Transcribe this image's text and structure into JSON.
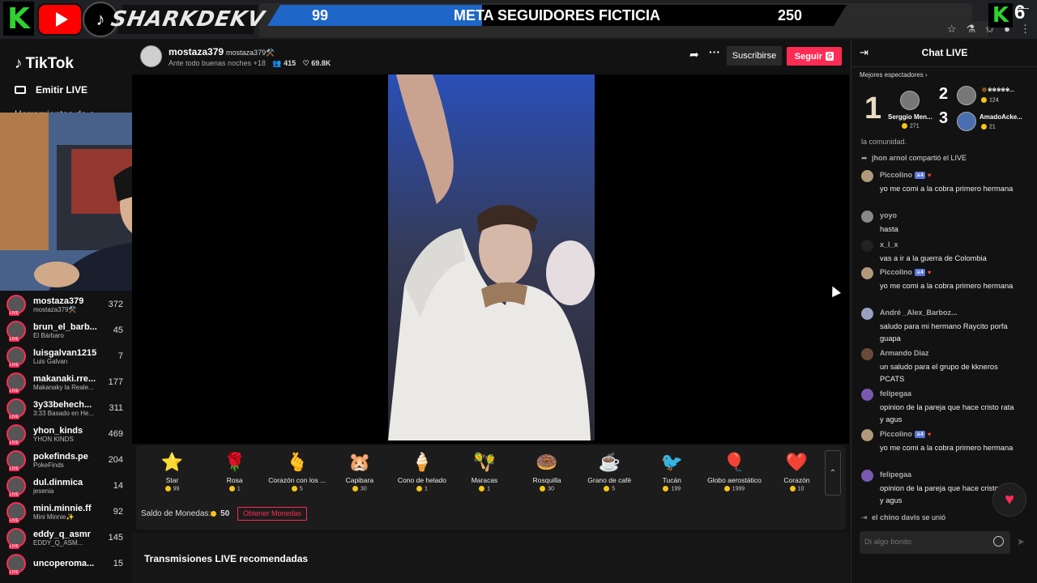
{
  "overlay": {
    "k_logo": "K",
    "brand": "SHARKDEKV",
    "goal": {
      "left": "99",
      "title": "META SEGUIDORES FICTICIA",
      "right": "250",
      "progress_fraction": 0.37
    },
    "k_right": "K",
    "k_count": "6"
  },
  "sidebar": {
    "logo": "TikTok",
    "emitir": "Emitir LIVE",
    "herramientas": "Herramientas de c",
    "following": [
      {
        "name": "mostaza379",
        "sub": "mostaza379⚒️",
        "count": "372"
      },
      {
        "name": "brun_el_barb...",
        "sub": "El Bárbaro",
        "count": "45"
      },
      {
        "name": "luisgalvan1215",
        "sub": "Luis Galvan",
        "count": "7"
      },
      {
        "name": "makanaki.rre...",
        "sub": "Makanaky la Reale...",
        "count": "177"
      },
      {
        "name": "3y33behech...",
        "sub": "3:33 Basado en He...",
        "count": "311"
      },
      {
        "name": "yhon_kinds",
        "sub": "YHON KINDS",
        "count": "469"
      },
      {
        "name": "pokefinds.pe",
        "sub": "PokeFinds",
        "count": "204"
      },
      {
        "name": "dul.dinmica",
        "sub": "jesenia",
        "count": "14"
      },
      {
        "name": "mini.minnie.ff",
        "sub": "Mini Minnie✨",
        "count": "92"
      },
      {
        "name": "eddy_q_asmr",
        "sub": "EDDY_Q_ASM...",
        "count": "145"
      },
      {
        "name": "uncoperoma...",
        "sub": "",
        "count": "15"
      }
    ]
  },
  "header": {
    "name": "mostaza379",
    "handle": "mostaza379⚒️",
    "title": "Ante todo buenas noches +18",
    "viewers": "415",
    "likes": "69.8K",
    "subscribe": "Suscribirse",
    "follow": "Seguir",
    "follow_badge": "G"
  },
  "gifts": [
    {
      "icon": "⭐",
      "name": "Star",
      "price": "99"
    },
    {
      "icon": "🌹",
      "name": "Rosa",
      "price": "1"
    },
    {
      "icon": "🫰",
      "name": "Corazón con los ...",
      "price": "5"
    },
    {
      "icon": "🐹",
      "name": "Capibara",
      "price": "30"
    },
    {
      "icon": "🍦",
      "name": "Cono de helado",
      "price": "1"
    },
    {
      "icon": "🪇",
      "name": "Maracas",
      "price": "1"
    },
    {
      "icon": "🍩",
      "name": "Rosquilla",
      "price": "30"
    },
    {
      "icon": "☕",
      "name": "Grano de café",
      "price": "5"
    },
    {
      "icon": "🐦",
      "name": "Tucán",
      "price": "199"
    },
    {
      "icon": "🎈",
      "name": "Globo aerostático",
      "price": "1999"
    },
    {
      "icon": "❤️",
      "name": "Corazón",
      "price": "10"
    }
  ],
  "balance": {
    "label": "Saldo de Monedas:",
    "value": "50",
    "get_coins": "Obtener Monedas"
  },
  "recommended": "Transmisiones LIVE recomendadas",
  "chat": {
    "title": "Chat LIVE",
    "best_viewers": "Mejores espectadores",
    "top": [
      {
        "rank": "1",
        "name": "Serggio Men...",
        "coins": "271"
      },
      {
        "rank": "2",
        "name": "🔅※※※※※...",
        "coins": "124"
      },
      {
        "rank": "3",
        "name": "AmadoAcke...",
        "coins": "21"
      }
    ],
    "partial_line": "la comunidad.",
    "shared": {
      "name": "jhon arnol",
      "text": "compartió el LIVE"
    },
    "messages": [
      {
        "name": "Piccolino",
        "level": "4",
        "text": "yo me comi a la cobra primero hermana"
      },
      {
        "name": "yoyo",
        "level": "",
        "text": "hasta"
      },
      {
        "name": "x_l_x",
        "level": "",
        "text": "vas a ir a la guerra de Colombia"
      },
      {
        "name": "Piccolino",
        "level": "4",
        "text": "yo me comi a la cobra primero hermana"
      },
      {
        "name": "André _Alex_Barboz...",
        "level": "",
        "text": "saludo para mi hermano Raycito porfa guapa"
      },
      {
        "name": "Armando Diaz",
        "level": "",
        "text": "un saludo para el grupo de kkneros PCATS"
      },
      {
        "name": "felipegaa",
        "level": "",
        "text": "opinion de la pareja que hace cristo rata y agus"
      },
      {
        "name": "Piccolino",
        "level": "4",
        "text": "yo me comi a la cobra primero hermana"
      },
      {
        "name": "felipegaa",
        "level": "",
        "text": "opinion de la pareja que hace cristo rata y agus"
      }
    ],
    "joined": {
      "name": "el chino davis",
      "text": "se unió"
    },
    "input_placeholder": "Di algo bonito"
  }
}
